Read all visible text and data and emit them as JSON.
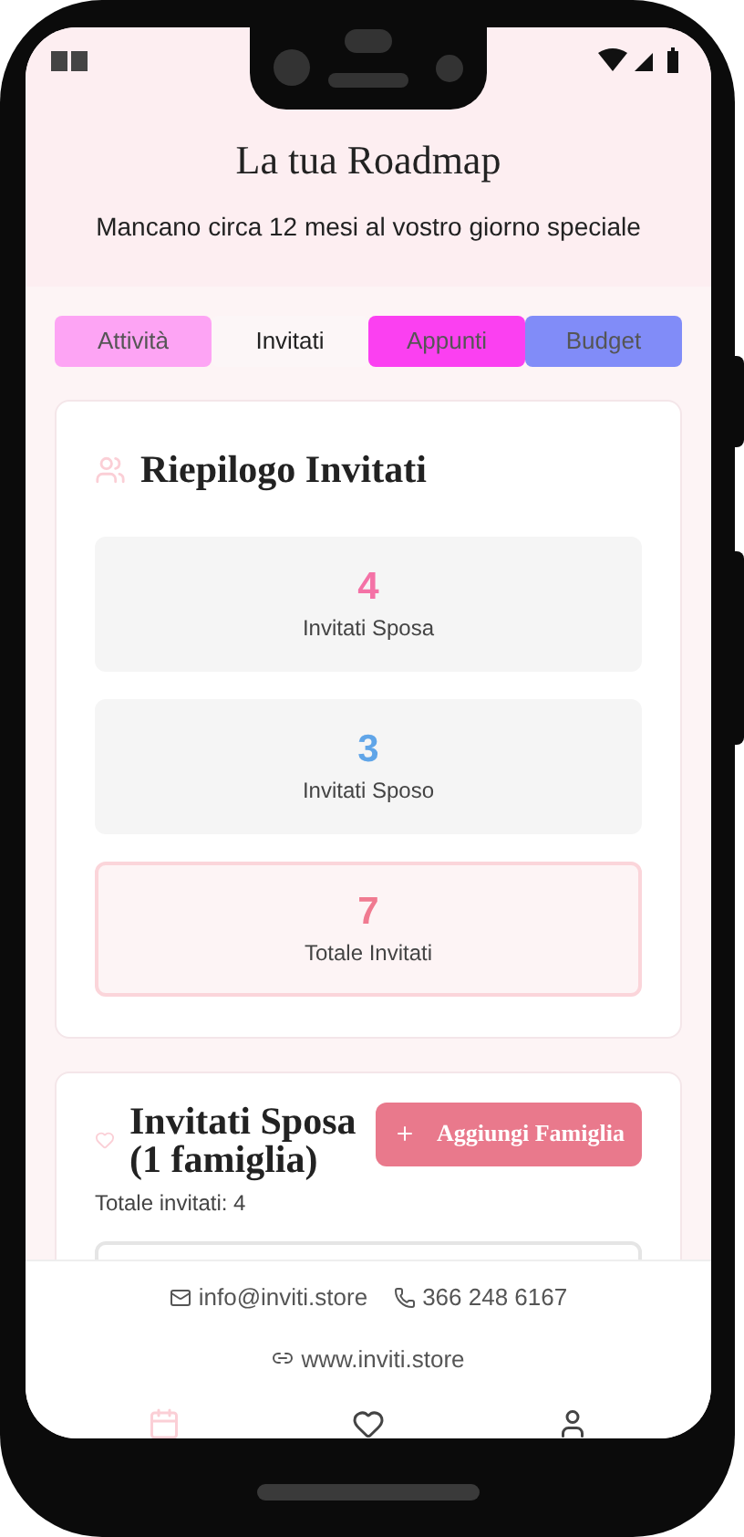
{
  "header": {
    "title": "La tua Roadmap",
    "subtitle": "Mancano circa 12 mesi al vostro giorno speciale"
  },
  "tabs": [
    {
      "label": "Attività",
      "selected": false,
      "color": "#fda4f4"
    },
    {
      "label": "Invitati",
      "selected": true,
      "color": "#fcf6f7"
    },
    {
      "label": "Appunti",
      "selected": false,
      "color": "#fb40f1"
    },
    {
      "label": "Budget",
      "selected": false,
      "color": "#818cf8"
    }
  ],
  "summary": {
    "title": "Riepilogo Invitati",
    "stats": [
      {
        "kind": "plain",
        "value": "4",
        "label": "Invitati Sposa",
        "color": "#f472a6"
      },
      {
        "kind": "plain",
        "value": "3",
        "label": "Invitati Sposo",
        "color": "#60a5e8"
      },
      {
        "kind": "outlined",
        "value": "7",
        "label": "Totale Invitati",
        "color": "#f07a90"
      }
    ]
  },
  "bride_section": {
    "title": "Invitati Sposa (1 famiglia)",
    "button": "Aggiungi Famiglia",
    "total": "Totale invitati: 4"
  },
  "footer": {
    "email": "info@inviti.store",
    "phone": "366 248 6167",
    "website": "www.inviti.store"
  },
  "bottom_nav": [
    {
      "kind": "calendar",
      "selected": true
    },
    {
      "kind": "heart",
      "selected": false
    },
    {
      "kind": "user",
      "selected": false
    }
  ]
}
